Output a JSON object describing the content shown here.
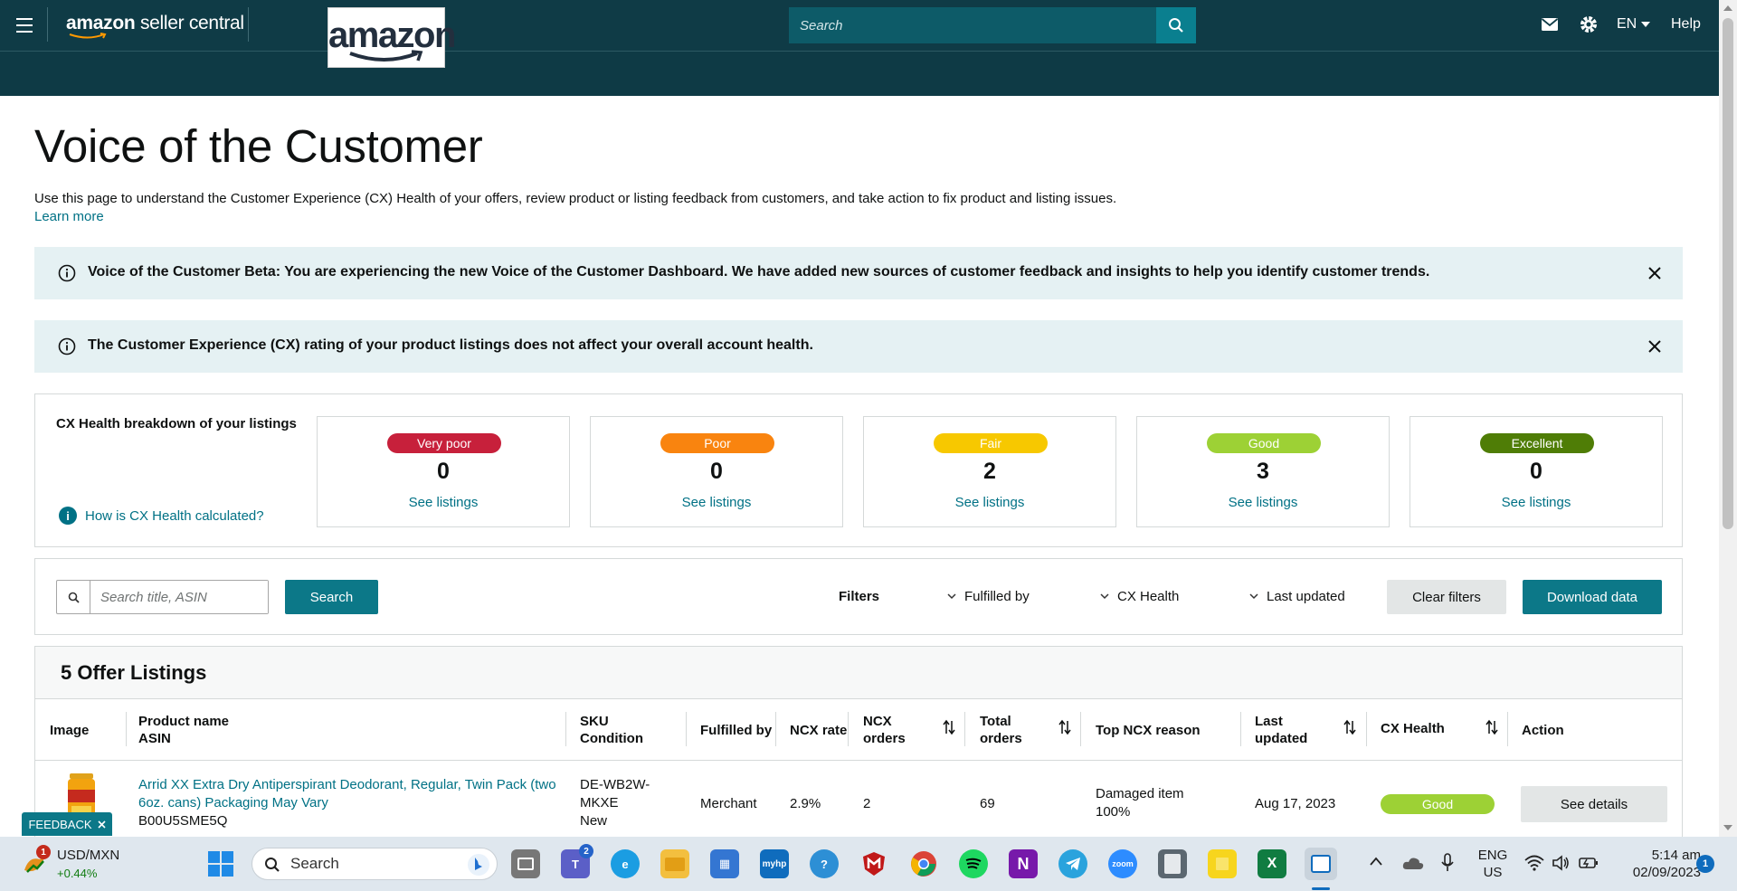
{
  "header": {
    "brand_bold": "amazon",
    "brand_rest": "seller central",
    "logo_text": "amazon",
    "search_placeholder": "Search",
    "lang": "EN",
    "help": "Help"
  },
  "page": {
    "title": "Voice of the Customer",
    "description": "Use this page to understand the Customer Experience (CX) Health of your offers, review product or listing feedback from customers, and take action to fix product and listing issues.",
    "learn_more": "Learn more"
  },
  "alerts": [
    {
      "text": "Voice of the Customer Beta: You are experiencing the new Voice of the Customer Dashboard. We have added new sources of customer feedback and insights to help you identify customer trends."
    },
    {
      "text": "The Customer Experience (CX) rating of your product listings does not affect your overall account health."
    }
  ],
  "health": {
    "label": "CX Health breakdown of your listings",
    "help_link": "How is CX Health calculated?",
    "see_listings": "See listings",
    "cards": [
      {
        "label": "Very poor",
        "count": "0",
        "color": "#c7203b"
      },
      {
        "label": "Poor",
        "count": "0",
        "color": "#f9840f"
      },
      {
        "label": "Fair",
        "count": "2",
        "color": "#f7c800"
      },
      {
        "label": "Good",
        "count": "3",
        "color": "#9dd135"
      },
      {
        "label": "Excellent",
        "count": "0",
        "color": "#4f7d06"
      }
    ]
  },
  "filters": {
    "search_placeholder": "Search title, ASIN",
    "search_button": "Search",
    "label": "Filters",
    "fulfilled_by": "Fulfilled by",
    "cx_health": "CX Health",
    "last_updated": "Last updated",
    "clear": "Clear filters",
    "download": "Download data"
  },
  "table": {
    "title": "5 Offer Listings",
    "headers": {
      "image": "Image",
      "product_name": "Product name",
      "asin": "ASIN",
      "sku": "SKU",
      "condition": "Condition",
      "fulfilled_by": "Fulfilled by",
      "ncx_rate": "NCX rate",
      "ncx_orders_1": "NCX",
      "ncx_orders_2": "orders",
      "total_orders_1": "Total",
      "total_orders_2": "orders",
      "top_ncx": "Top NCX reason",
      "last_updated_1": "Last",
      "last_updated_2": "updated",
      "cx_health": "CX Health",
      "action": "Action"
    },
    "rows": [
      {
        "product_line1": "Arrid XX Extra Dry Antiperspirant Deodorant, Regular, Twin Pack (two",
        "product_line2": "6oz. cans) Packaging May Vary",
        "asin": "B00U5SME5Q",
        "sku_line1": "DE-WB2W-",
        "sku_line2": "MKXE",
        "condition": "New",
        "fulfilled_by": "Merchant",
        "ncx_rate": "2.9%",
        "ncx_orders": "2",
        "total_orders": "69",
        "reason_line1": "Damaged item",
        "reason_line2": "100%",
        "last_updated": "Aug 17, 2023",
        "cx_health": "Good",
        "action": "See details"
      }
    ]
  },
  "feedback": "FEEDBACK",
  "taskbar": {
    "ticker": "USD/MXN",
    "ticker_change": "+0.44%",
    "ticker_badge": "1",
    "search": "Search",
    "teams_badge": "2",
    "lang_1": "ENG",
    "lang_2": "US",
    "time": "5:14 am",
    "date": "02/09/2023",
    "notif": "1",
    "myhp": "myhp",
    "zoom": "zoom",
    "onenote": "N",
    "excel": "X"
  }
}
